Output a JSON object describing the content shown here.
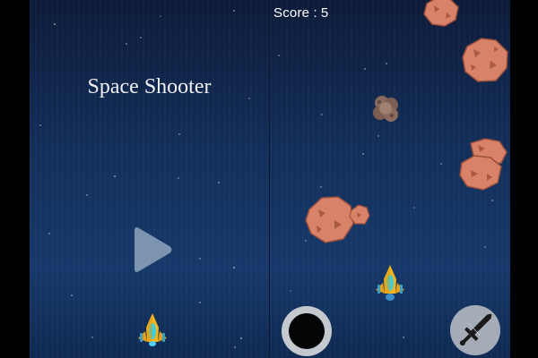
{
  "start_screen": {
    "title": "Space Shooter",
    "play_icon": "play-triangle-icon"
  },
  "game_screen": {
    "score_label": "Score :",
    "score_value": "5",
    "controls": {
      "joystick_icon": "joystick-icon",
      "fire_icon": "sword-icon"
    }
  },
  "colors": {
    "background_top": "#0d1b3a",
    "background_bottom": "#16386a",
    "asteroid": "#d9826a",
    "asteroid_dark": "#8a6a5c",
    "ship_body": "#f2b51e",
    "ship_cockpit": "#3ad0e0"
  }
}
